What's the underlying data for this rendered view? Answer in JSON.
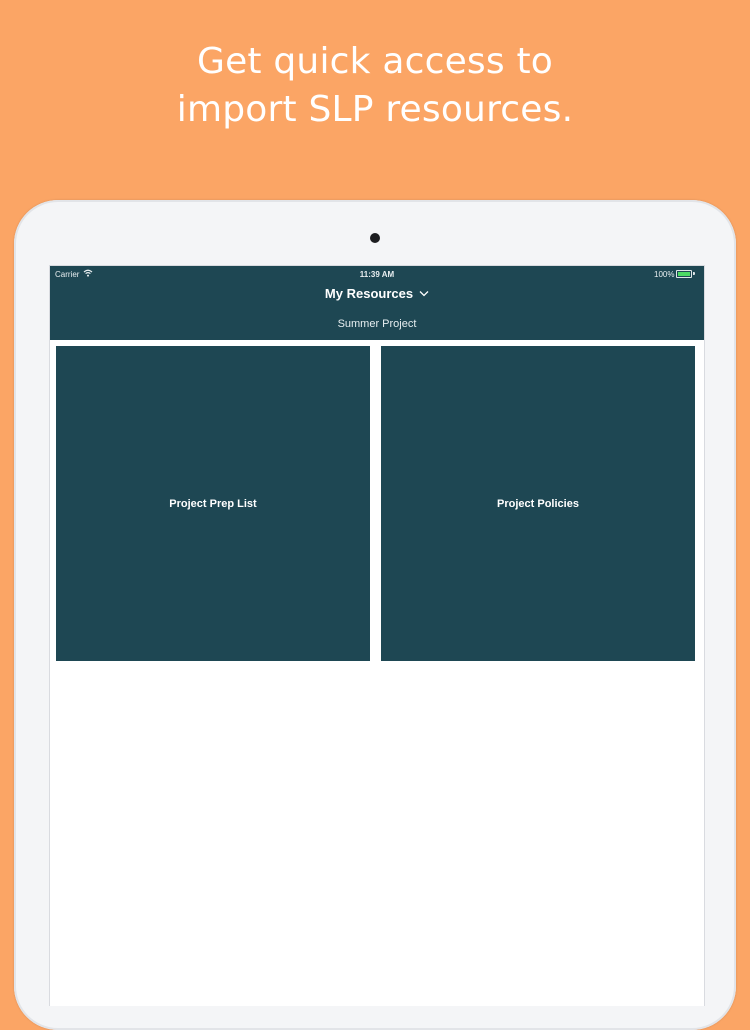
{
  "headline": {
    "line1": "Get quick access to",
    "line2": "import SLP resources."
  },
  "status_bar": {
    "carrier": "Carrier",
    "time": "11:39 AM",
    "battery": "100%"
  },
  "nav": {
    "title": "My Resources",
    "subtitle": "Summer Project"
  },
  "tiles": [
    {
      "label": "Project Prep List"
    },
    {
      "label": "Project Policies"
    }
  ],
  "colors": {
    "background": "#FBA565",
    "primary": "#1E4753",
    "battery": "#4CD964"
  },
  "icons": [
    "wifi-icon",
    "battery-icon",
    "chevron-down-icon"
  ]
}
